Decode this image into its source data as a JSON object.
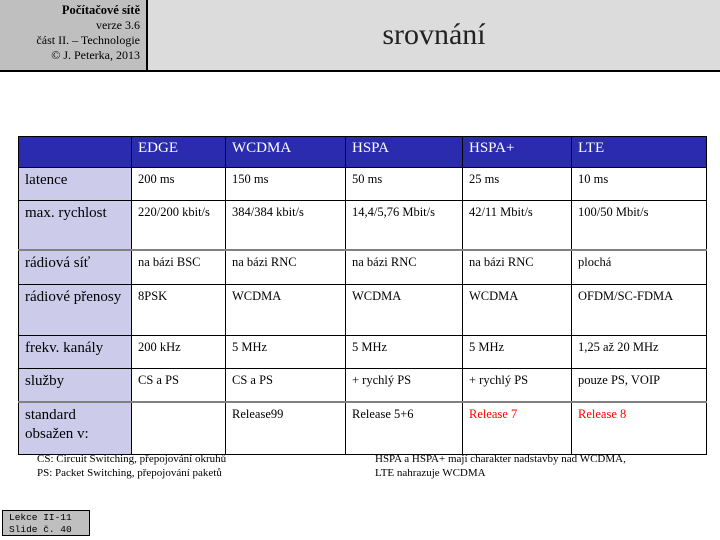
{
  "header": {
    "logo": {
      "line1": "Počítačové sítě",
      "line2": "verze 3.6",
      "line3": "část II. – Technologie",
      "line4": "© J. Peterka, 2013"
    },
    "title": "srovnání"
  },
  "table": {
    "corner": "",
    "columns": [
      "EDGE",
      "WCDMA",
      "HSPA",
      "HSPA+",
      "LTE"
    ],
    "rows": [
      {
        "label": "latence",
        "cells": [
          "200 ms",
          "150 ms",
          "50 ms",
          "25 ms",
          "10 ms"
        ]
      },
      {
        "label": "max. rychlost",
        "cells": [
          "220/200 kbit/s",
          "384/384 kbit/s",
          "14,4/5,76 Mbit/s",
          "42/11 Mbit/s",
          "100/50 Mbit/s"
        ]
      },
      {
        "label": "rádiová síť",
        "cells": [
          "na bázi BSC",
          "na bázi RNC",
          "na bázi RNC",
          "na bázi RNC",
          "plochá"
        ]
      },
      {
        "label": "rádiové přenosy",
        "cells": [
          "8PSK",
          "WCDMA",
          "WCDMA",
          "WCDMA",
          "OFDM/SC-FDMA"
        ]
      },
      {
        "label": "frekv. kanály",
        "cells": [
          "200 kHz",
          "5 MHz",
          "5 MHz",
          "5 MHz",
          "1,25 až 20 MHz"
        ]
      },
      {
        "label": "služby",
        "cells": [
          "CS a PS",
          "CS a PS",
          "+ rychlý  PS",
          "+ rychlý  PS",
          "pouze PS, VOIP"
        ]
      },
      {
        "label": "standard obsažen v:",
        "cells": [
          "",
          "Release99",
          "Release  5+6",
          "Release  7",
          "Release  8"
        ]
      }
    ]
  },
  "notes": {
    "left_line1": "CS: Circuit Switching, přepojování okruhů",
    "left_line2": "PS: Packet Switching,  přepojování paketů",
    "right_line1": "HSPA a HSPA+ mají  charakter  nadstavby nad WCDMA,",
    "right_line2": "LTE nahrazuje WCDMA"
  },
  "slide_badge": {
    "line1": "Lekce II-11",
    "line2": "Slide č. 40"
  },
  "colors": {
    "header_blue": "#2b2bb0",
    "row_label_bg": "#ccccea",
    "accent_red": "#ff0000",
    "logo_gray": "#bfbfbf",
    "title_gray": "#dcdcdc"
  }
}
